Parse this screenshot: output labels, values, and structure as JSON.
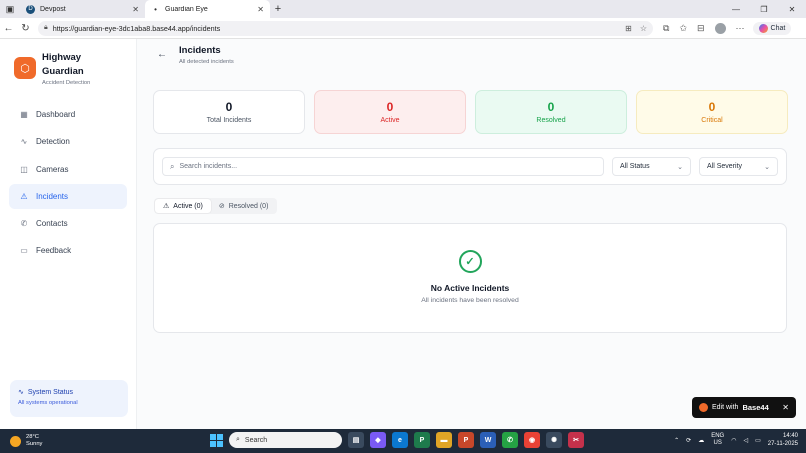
{
  "browser": {
    "tabs": [
      {
        "title": "Devpost",
        "active": false
      },
      {
        "title": "Guardian Eye",
        "active": true
      }
    ],
    "url": "https://guardian-eye-3dc1aba8.base44.app/incidents",
    "chat_label": "Chat"
  },
  "sidebar": {
    "brand_name": "Highway Guardian",
    "brand_sub": "Accident Detection",
    "items": [
      {
        "label": "Dashboard",
        "icon": "dashboard-icon",
        "active": false
      },
      {
        "label": "Detection",
        "icon": "activity-icon",
        "active": false
      },
      {
        "label": "Cameras",
        "icon": "camera-icon",
        "active": false
      },
      {
        "label": "Incidents",
        "icon": "warning-icon",
        "active": true
      },
      {
        "label": "Contacts",
        "icon": "phone-icon",
        "active": false
      },
      {
        "label": "Feedback",
        "icon": "message-icon",
        "active": false
      }
    ],
    "status_title": "System Status",
    "status_sub": "All systems operational"
  },
  "header": {
    "title": "Incidents",
    "subtitle": "All detected incidents"
  },
  "stats": [
    {
      "value": "0",
      "label": "Total Incidents"
    },
    {
      "value": "0",
      "label": "Active"
    },
    {
      "value": "0",
      "label": "Resolved"
    },
    {
      "value": "0",
      "label": "Critical"
    }
  ],
  "filters": {
    "search_placeholder": "Search incidents...",
    "status_value": "All Status",
    "severity_value": "All Severity"
  },
  "tabs": [
    {
      "label": "Active (0)",
      "selected": true
    },
    {
      "label": "Resolved (0)",
      "selected": false
    }
  ],
  "empty_state": {
    "title": "No Active Incidents",
    "subtitle": "All incidents have been resolved"
  },
  "edit_badge": {
    "label": "Edit with",
    "brand": "Base44"
  },
  "taskbar": {
    "temperature": "28°C",
    "weather": "Sunny",
    "search_label": "Search",
    "lang_line1": "ENG",
    "lang_line2": "US",
    "time": "14:40",
    "date": "27-11-2025"
  },
  "colors": {
    "accent": "#2563eb",
    "brand": "#f06a2a",
    "active_red": "#dc2626",
    "resolved_green": "#16a34a",
    "critical_amber": "#d97706"
  }
}
